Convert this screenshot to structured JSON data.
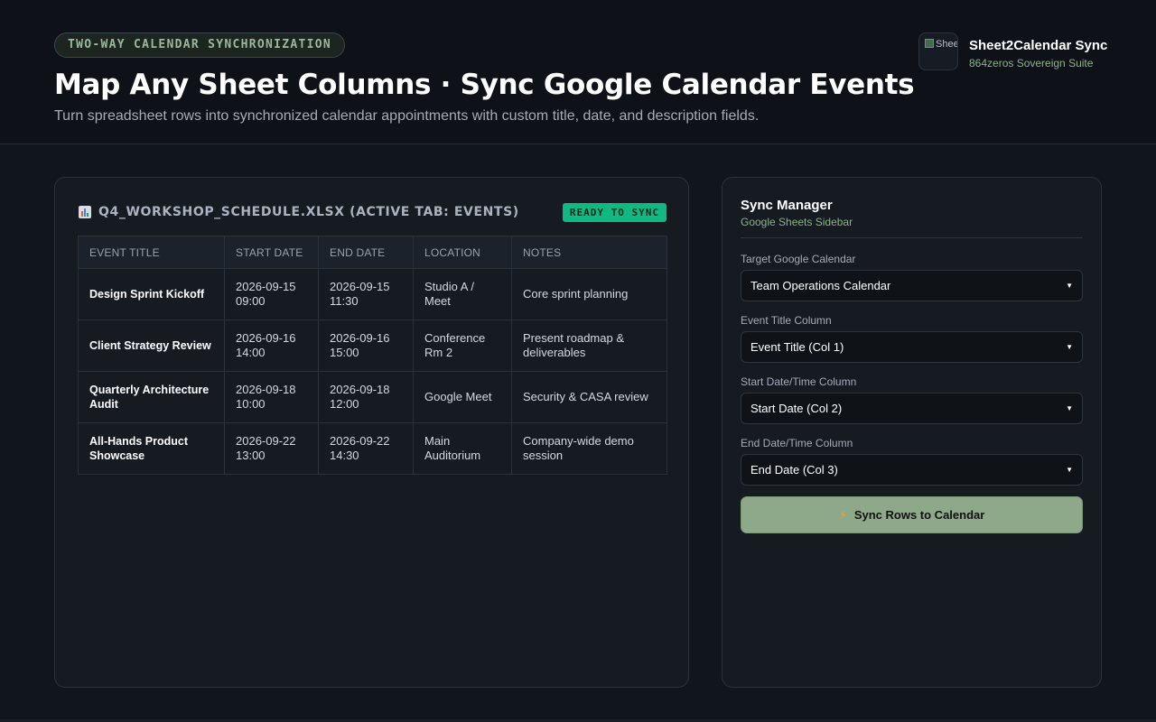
{
  "hero": {
    "pill": "TWO-WAY CALENDAR SYNCHRONIZATION",
    "title": "Map Any Sheet Columns · Sync Google Calendar Events",
    "subtitle": "Turn spreadsheet rows into synchronized calendar appointments with custom title, date, and description fields."
  },
  "brand": {
    "logo_alt": "Sheet",
    "name": "Sheet2Calendar Sync",
    "tagline": "864zeros Sovereign Suite"
  },
  "sheet": {
    "file_label": "Q4_WORKSHOP_SCHEDULE.XLSX (ACTIVE TAB: EVENTS)",
    "status_badge": "READY TO SYNC",
    "columns": [
      "EVENT TITLE",
      "START DATE",
      "END DATE",
      "LOCATION",
      "NOTES"
    ],
    "rows": [
      [
        "Design Sprint Kickoff",
        "2026-09-15 09:00",
        "2026-09-15 11:30",
        "Studio A / Meet",
        "Core sprint planning"
      ],
      [
        "Client Strategy Review",
        "2026-09-16 14:00",
        "2026-09-16 15:00",
        "Conference Rm 2",
        "Present roadmap & deliverables"
      ],
      [
        "Quarterly Architecture Audit",
        "2026-09-18 10:00",
        "2026-09-18 12:00",
        "Google Meet",
        "Security & CASA review"
      ],
      [
        "All-Hands Product Showcase",
        "2026-09-22 13:00",
        "2026-09-22 14:30",
        "Main Auditorium",
        "Company-wide demo session"
      ]
    ]
  },
  "sidebar": {
    "title": "Sync Manager",
    "subtitle": "Google Sheets Sidebar",
    "fields": [
      {
        "label": "Target Google Calendar",
        "value": "Team Operations Calendar"
      },
      {
        "label": "Event Title Column",
        "value": "Event Title (Col 1)"
      },
      {
        "label": "Start Date/Time Column",
        "value": "Start Date (Col 2)"
      },
      {
        "label": "End Date/Time Column",
        "value": "End Date (Col 3)"
      }
    ],
    "sync_label": "Sync Rows to Calendar"
  },
  "icons": {
    "file": "chart-icon",
    "sync": "lightning-icon",
    "caret": "chevron-down-icon"
  },
  "colors": {
    "accent_green": "#10b981",
    "sync_button": "#8ea88a",
    "tagline_green": "#8fb08a",
    "background": "#11151c"
  }
}
